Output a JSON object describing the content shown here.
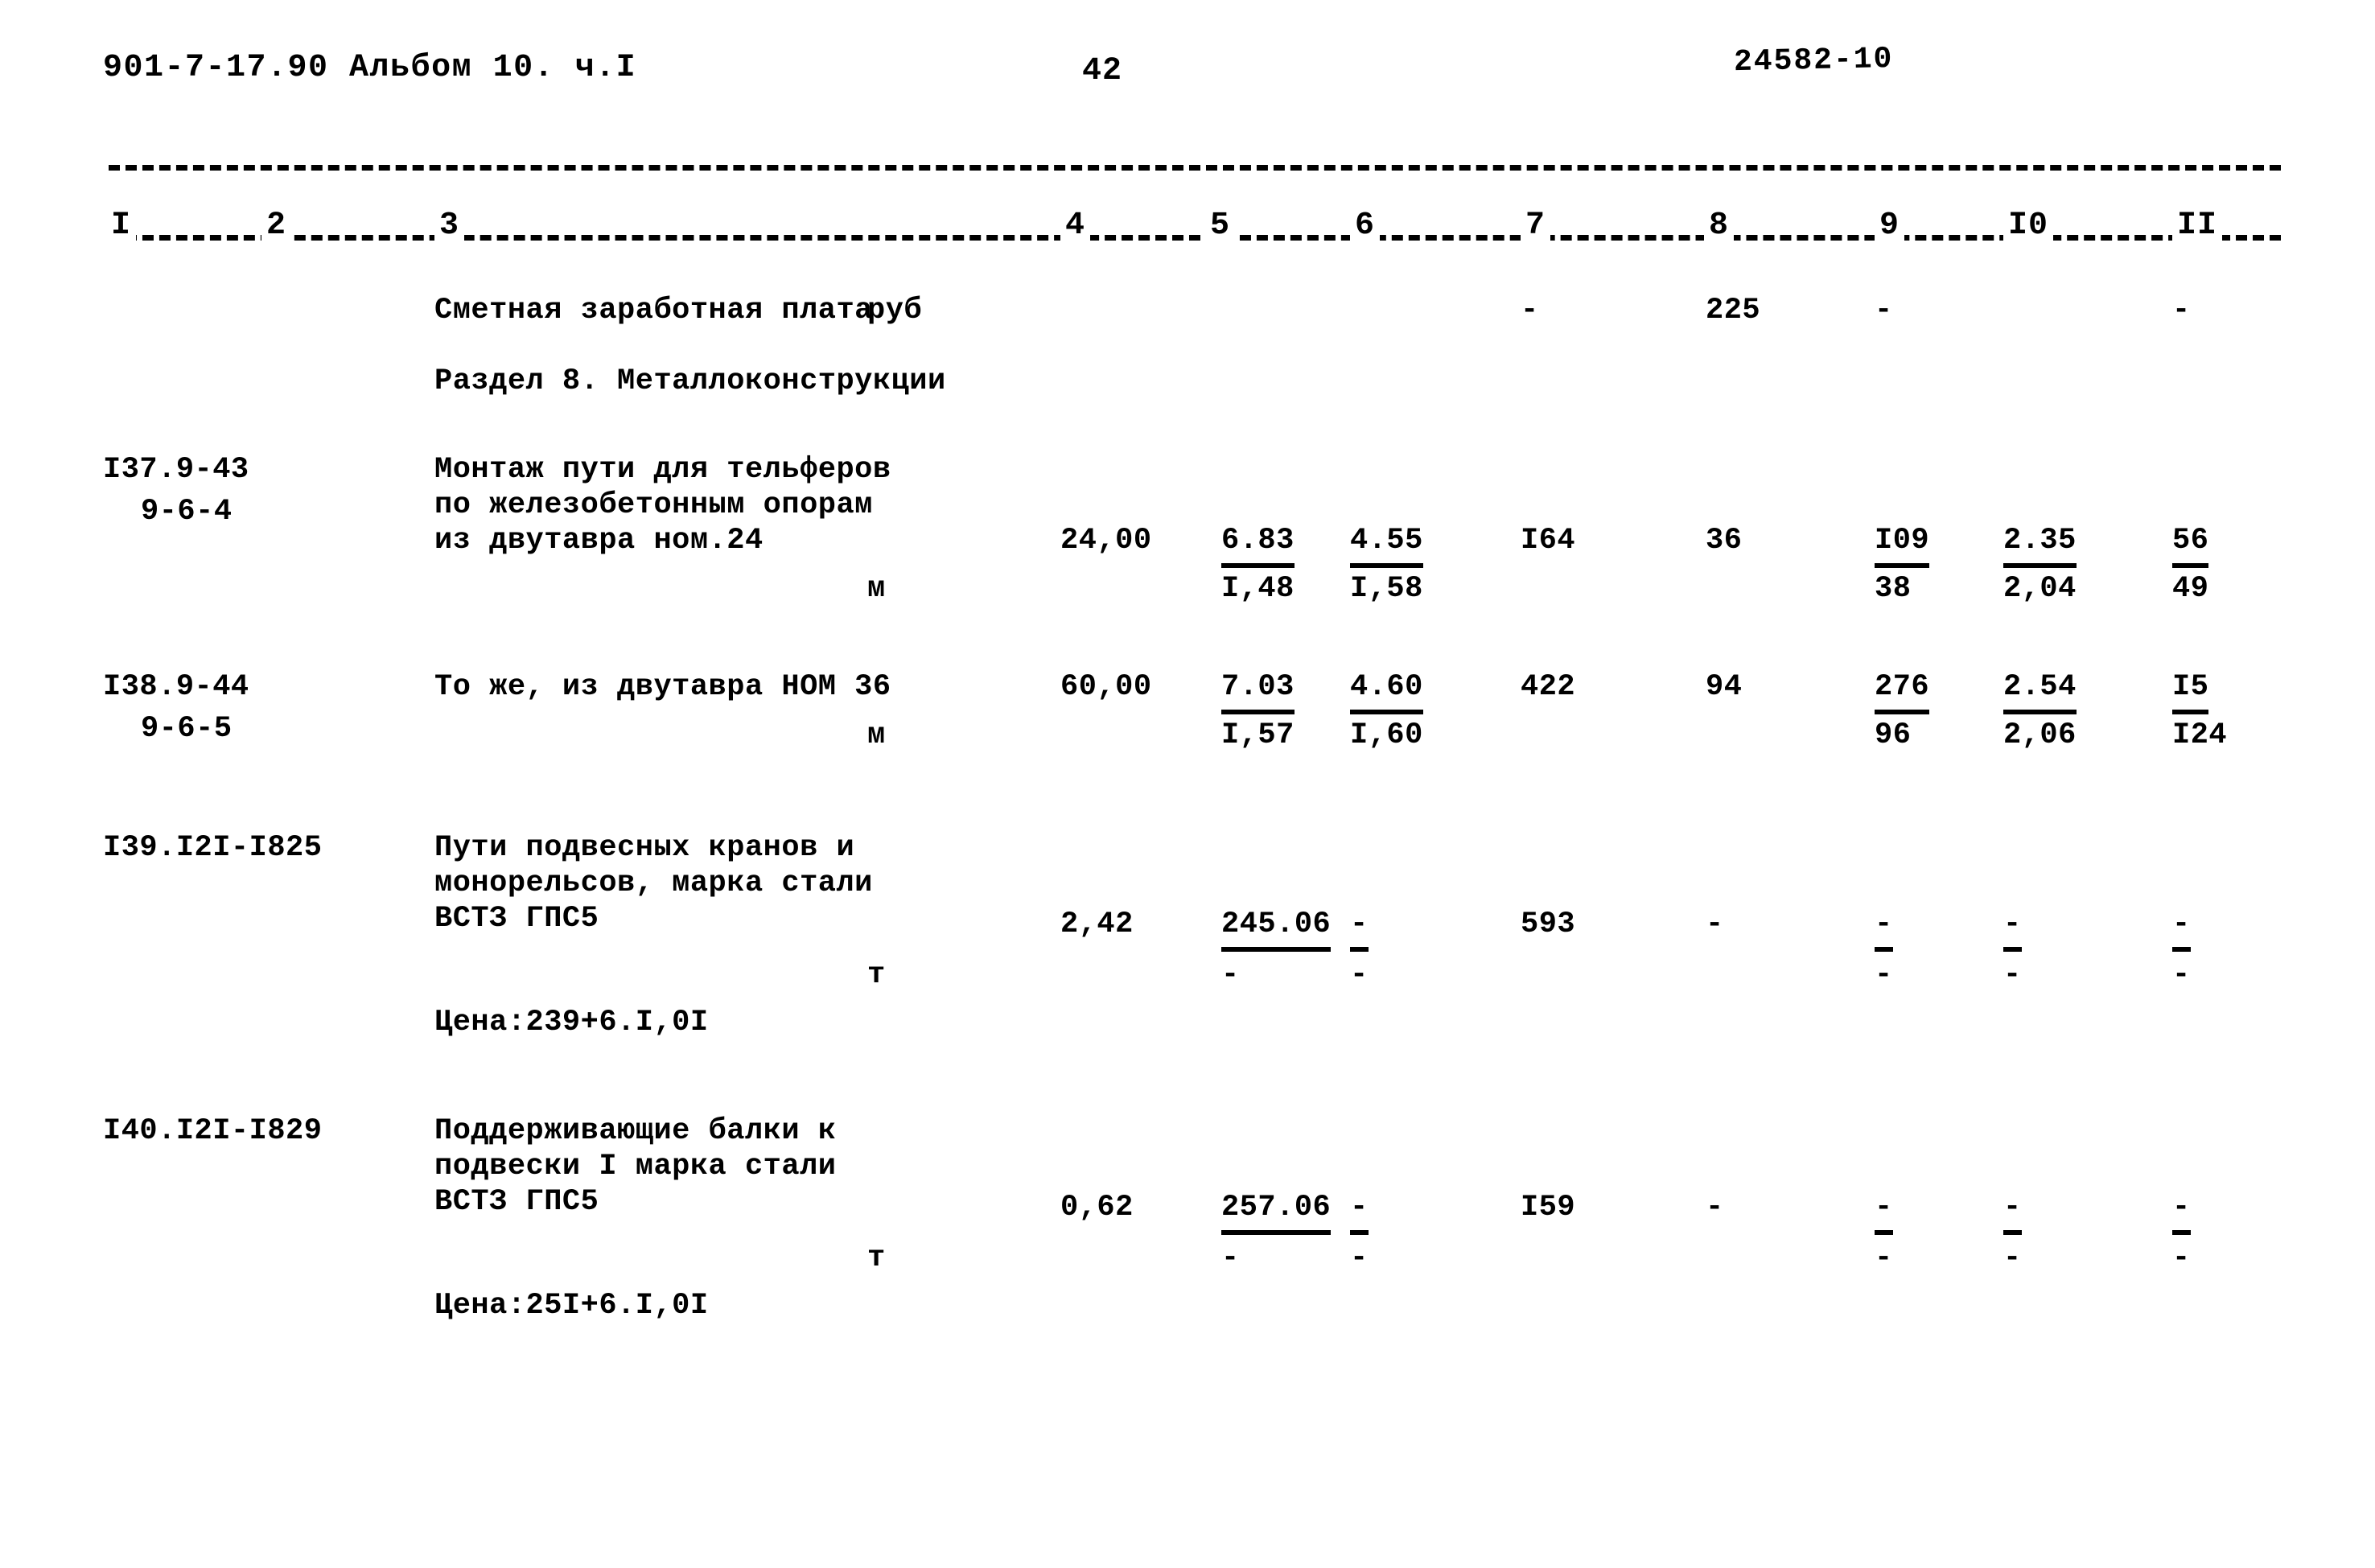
{
  "header": {
    "doc_code": "901-7-17.90  Альбом 10. ч.I",
    "page_number": "42",
    "archive_stamp": "24582-10"
  },
  "table": {
    "column_numbers": [
      "I",
      "2",
      "3",
      "4",
      "5",
      "6",
      "7",
      "8",
      "9",
      "I0",
      "II"
    ],
    "rows": {
      "salary": {
        "description": "Сметная заработная плата",
        "unit": "руб",
        "col7": "-",
        "col8": "225",
        "col9": "-",
        "col11": "-"
      },
      "section": {
        "title": "Раздел 8. Металлоконструкции"
      },
      "row137": {
        "code": "I37.9-43",
        "code2": "9-6-4",
        "desc1": "Монтаж пути для тельферов",
        "desc2": "по железобетонным опорам",
        "desc3": "из двутавра ном.24",
        "unit": "м",
        "qty": "24,00",
        "col5_top": "6.83",
        "col5_bottom": "I,48",
        "col6_top": "4.55",
        "col6_bottom": "I,58",
        "col7": "I64",
        "col8": "36",
        "col9_top": "I09",
        "col9_bottom": "38",
        "col10_top": "2.35",
        "col10_bottom": "2,04",
        "col11_top": "56",
        "col11_bottom": "49"
      },
      "row138": {
        "code": "I38.9-44",
        "code2": "9-6-5",
        "desc1": "То же, из двутавра НОМ 36",
        "unit": "м",
        "qty": "60,00",
        "col5_top": "7.03",
        "col5_bottom": "I,57",
        "col6_top": "4.60",
        "col6_bottom": "I,60",
        "col7": "422",
        "col8": "94",
        "col9_top": "276",
        "col9_bottom": "96",
        "col10_top": "2.54",
        "col10_bottom": "2,06",
        "col11_top": "I5",
        "col11_bottom": "I24"
      },
      "row139": {
        "code": "I39.I2I-I825",
        "desc1": "Пути подвесных кранов и",
        "desc2": "монорельсов, марка стали",
        "desc3": "ВСТЗ ГПС5",
        "unit": "т",
        "qty": "2,42",
        "col5_top": "245.06",
        "col5_bottom": "-",
        "col6_top": "-",
        "col6_bottom": "-",
        "col7": "593",
        "col8": "-",
        "col9_top": "-",
        "col9_bottom": "-",
        "col10_top": "-",
        "col10_bottom": "-",
        "col11_top": "-",
        "col11_bottom": "-",
        "price_note": "Цена:239+6.I,0I"
      },
      "row140": {
        "code": "I40.I2I-I829",
        "desc1": "Поддерживающие балки к",
        "desc2": "подвески I марка стали",
        "desc3": "ВСТЗ ГПС5",
        "unit": "т",
        "qty": "0,62",
        "col5_top": "257.06",
        "col5_bottom": "-",
        "col6_top": "-",
        "col6_bottom": "-",
        "col7": "I59",
        "col8": "-",
        "col9_top": "-",
        "col9_bottom": "-",
        "col10_top": "-",
        "col10_bottom": "-",
        "col11_top": "-",
        "col11_bottom": "-",
        "price_note": "Цена:25I+6.I,0I"
      }
    }
  }
}
